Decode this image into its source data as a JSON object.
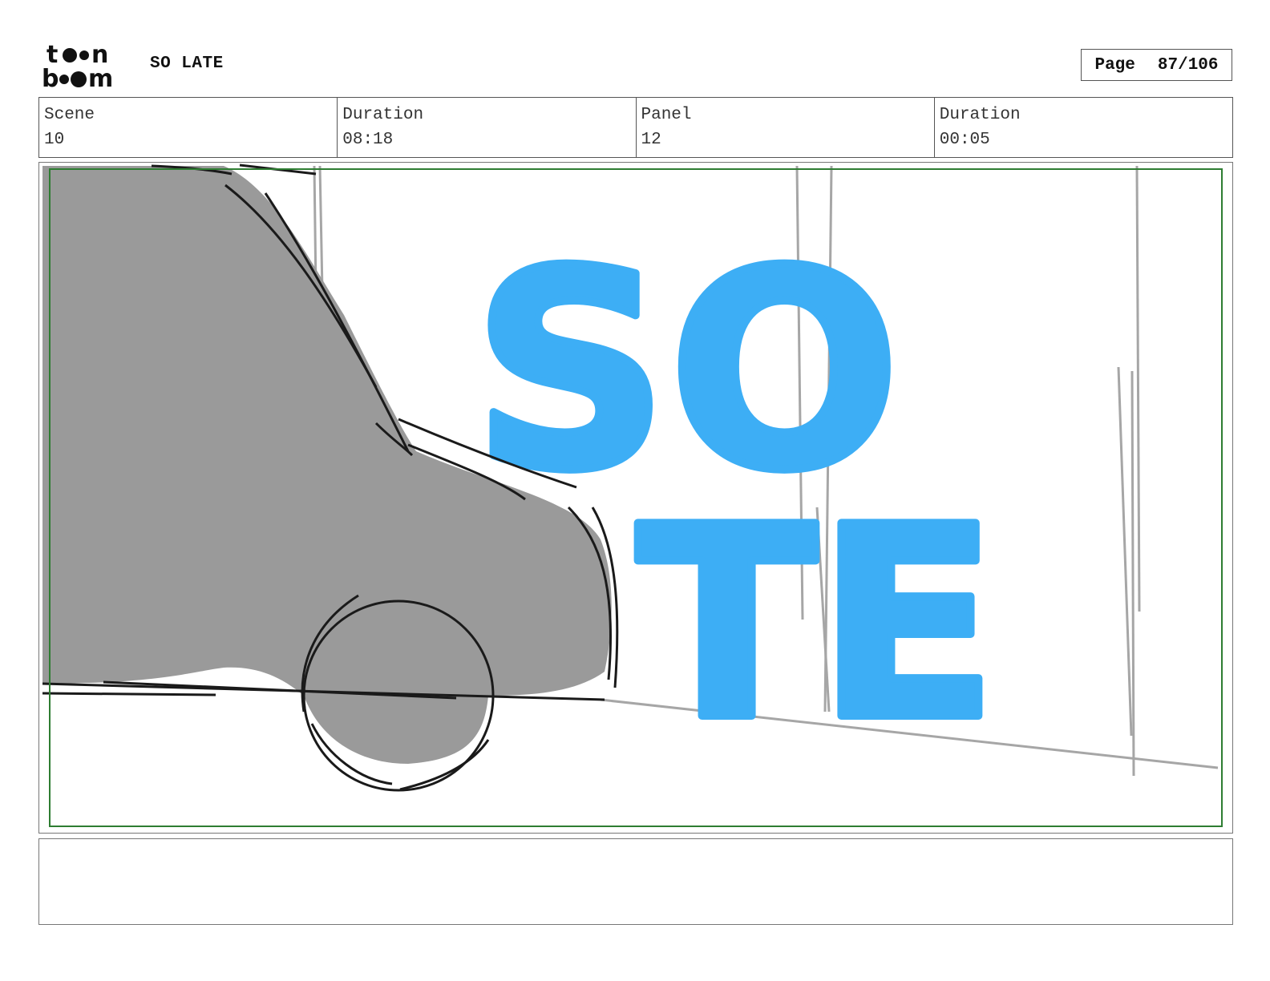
{
  "header": {
    "logo_text": "toon boom",
    "project_title": "SO LATE",
    "page_label": "Page",
    "page_number": "87/106"
  },
  "info": {
    "scene_label": "Scene",
    "scene_value": "10",
    "scene_duration_label": "Duration",
    "scene_duration_value": "08:18",
    "panel_label": "Panel",
    "panel_value": "12",
    "panel_duration_label": "Duration",
    "panel_duration_value": "00:05"
  },
  "panel": {
    "safe_frame_color": "#2e7d32",
    "letter_color": "#3daef5",
    "car_color": "#9a9a9a",
    "letters_top": "SO",
    "letters_bottom": "TE"
  },
  "notes": {
    "text": ""
  }
}
